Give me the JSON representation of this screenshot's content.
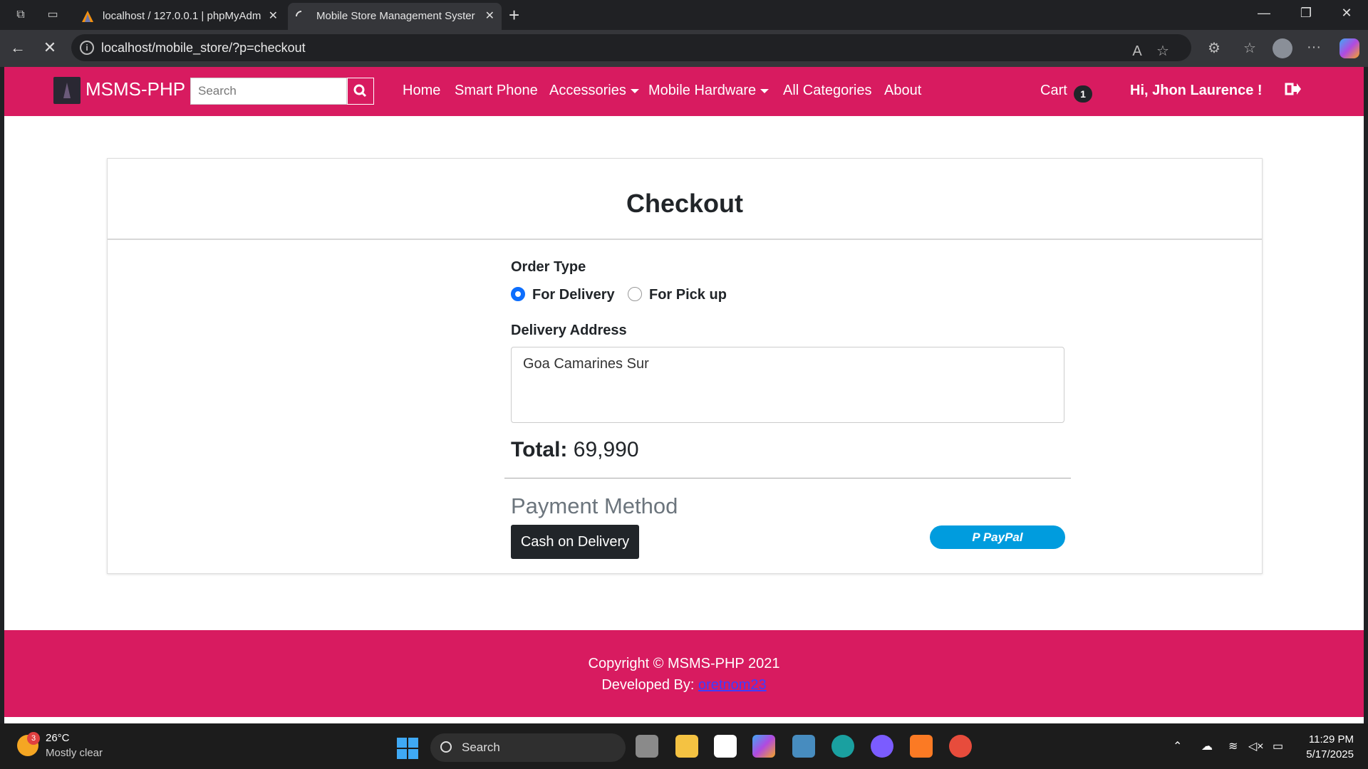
{
  "browser": {
    "tabs": [
      {
        "title": "localhost / 127.0.0.1 | phpMyAdm",
        "active": false
      },
      {
        "title": "Mobile Store Management Syster",
        "active": true
      }
    ],
    "url": "localhost/mobile_store/?p=checkout"
  },
  "navbar": {
    "brand": "MSMS-PHP",
    "search_placeholder": "Search",
    "links": [
      "Home",
      "Smart Phone",
      "Accessories",
      "Mobile Hardware",
      "All Categories",
      "About"
    ],
    "cart_label": "Cart",
    "cart_count": "1",
    "user_greeting": "Hi, Jhon Laurence !"
  },
  "checkout": {
    "title": "Checkout",
    "order_type_label": "Order Type",
    "option_delivery": "For Delivery",
    "option_pickup": "For Pick up",
    "selected_option": "For Delivery",
    "address_label": "Delivery Address",
    "address_value": "Goa Camarines Sur",
    "total_label": "Total:",
    "total_value": "69,990",
    "payment_heading": "Payment Method",
    "cod_label": "Cash on Delivery",
    "paypal_label": "PayPal"
  },
  "footer": {
    "copyright": "Copyright © MSMS-PHP 2021",
    "developed_by": "Developed By:",
    "developer_link": "oretnom23"
  },
  "taskbar": {
    "weather_temp": "26°C",
    "weather_desc": "Mostly clear",
    "weather_badge": "3",
    "search_label": "Search",
    "time": "11:29 PM",
    "date": "5/17/2025"
  },
  "colors": {
    "brand": "#d81b60",
    "dark_button": "#212529",
    "paypal": "#009cde",
    "radio_selected": "#0d6efd"
  }
}
